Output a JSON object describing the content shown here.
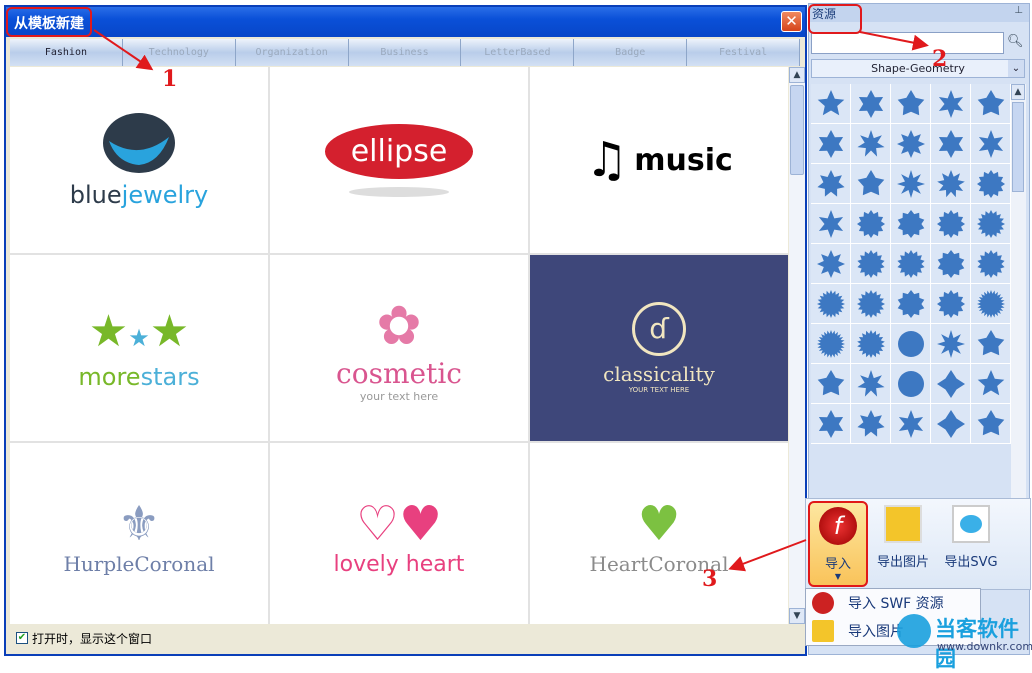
{
  "dialog": {
    "title": "从模板新建",
    "close_icon": "close-icon",
    "tabs": [
      "Fashion",
      "Technology",
      "Organization",
      "Business",
      "LetterBased",
      "Badge",
      "Festival"
    ],
    "active_tab": "Fashion",
    "templates": [
      {
        "name": "bluejewelry",
        "parts": [
          "blue",
          "jewelry"
        ],
        "colors": [
          "#2d3b4a",
          "#29a3dd"
        ]
      },
      {
        "name": "ellipse",
        "colors": [
          "#d4202e"
        ]
      },
      {
        "name": "music",
        "colors": [
          "#111111"
        ]
      },
      {
        "name": "morestars",
        "parts": [
          "more",
          "stars"
        ],
        "colors": [
          "#78b829",
          "#4cb0d8"
        ]
      },
      {
        "name": "cosmetic",
        "tagline": "your text here",
        "colors": [
          "#d9558f"
        ]
      },
      {
        "name": "classicality",
        "tagline": "YOUR TEXT HERE",
        "colors": [
          "#f1e6c0",
          "#3e477a"
        ]
      },
      {
        "name": "HurpleCoronal",
        "colors": [
          "#6e7fa8"
        ]
      },
      {
        "name": "lovely heart",
        "colors": [
          "#e8407f"
        ]
      },
      {
        "name": "HeartCoronal",
        "colors": [
          "#8b8b8b",
          "#7cc141"
        ]
      }
    ],
    "show_on_open_label": "打开时，显示这个窗口",
    "show_on_open_checked": true
  },
  "panel": {
    "title": "资源",
    "search_placeholder": "",
    "category": "Shape-Geometry",
    "shape_color": "#3d78c2"
  },
  "ribbon": {
    "import_label": "导入",
    "export_image_label": "导出图片",
    "export_svg_label": "导出SVG"
  },
  "import_menu": [
    "导入 SWF 资源",
    "导入图片"
  ],
  "annotations": [
    "1",
    "2",
    "3"
  ],
  "watermark": {
    "name": "当客软件园",
    "url": "www.downkr.com"
  }
}
